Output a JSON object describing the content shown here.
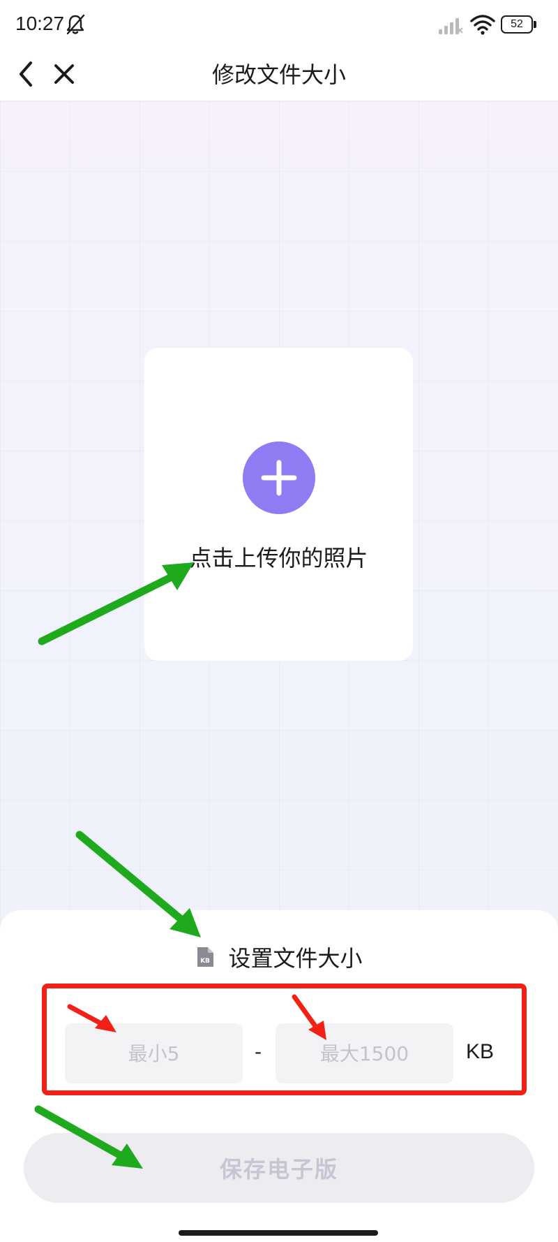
{
  "status_bar": {
    "time": "10:27",
    "battery": "52",
    "icons": [
      "bell-muted-icon",
      "signal-icon",
      "wifi-icon",
      "battery-icon"
    ]
  },
  "nav": {
    "title": "修改文件大小",
    "icons": [
      "back-icon",
      "close-icon"
    ]
  },
  "upload": {
    "label": "点击上传你的照片",
    "icon": "plus-icon"
  },
  "size_settings": {
    "title": "设置文件大小",
    "icon": "kb-file-icon",
    "min_placeholder": "最小5",
    "min_value": "",
    "separator": "-",
    "max_placeholder": "最大1500",
    "max_value": "",
    "unit": "KB"
  },
  "actions": {
    "save_label": "保存电子版"
  },
  "colors": {
    "accent": "#8f7cf2",
    "annotation_green": "#1faa1e",
    "annotation_red": "#f22016",
    "button_disabled_bg": "#ececf1",
    "button_disabled_text": "#c7c5d3"
  }
}
